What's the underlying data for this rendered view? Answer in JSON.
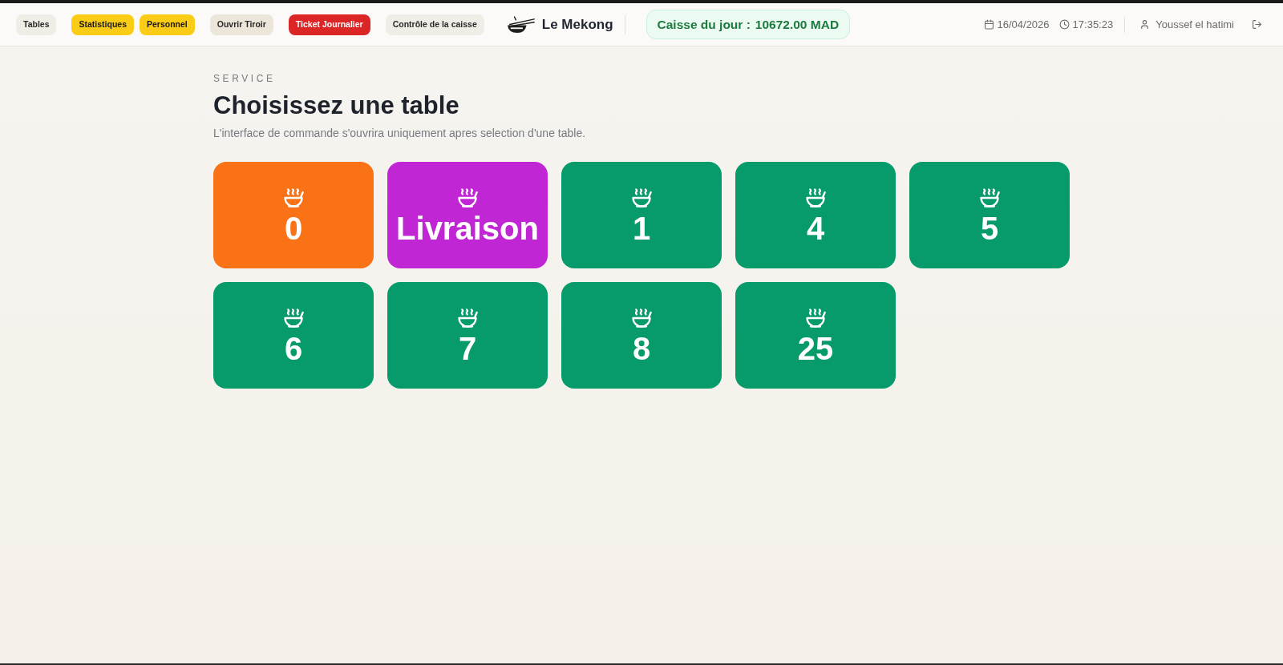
{
  "header": {
    "nav_groups": [
      {
        "buttons": [
          {
            "label": "Tables",
            "kind": "plain"
          }
        ]
      },
      {
        "buttons": [
          {
            "label": "Statistiques",
            "kind": "accent"
          },
          {
            "label": "Personnel",
            "kind": "accent"
          }
        ]
      },
      {
        "buttons": [
          {
            "label": "Ouvrir Tiroir",
            "kind": "muted"
          }
        ]
      },
      {
        "buttons": [
          {
            "label": "Ticket Journalier",
            "kind": "danger"
          }
        ]
      },
      {
        "buttons": [
          {
            "label": "Contrôle de la caisse",
            "kind": "plain"
          }
        ]
      }
    ],
    "brand": {
      "name": "Le Mekong"
    },
    "cash_badge": {
      "label": "Caisse du jour :",
      "value": "10672.00 MAD"
    },
    "date": "16/04/2026",
    "time": "17:35:23",
    "user": {
      "name": "Youssef el hatimi"
    }
  },
  "main": {
    "eyebrow": "SERVICE",
    "title": "Choisissez une table",
    "subtitle": "L'interface de commande s'ouvrira uniquement apres selection d'une table.",
    "tables": [
      {
        "label": "0",
        "color": "#f97316"
      },
      {
        "label": "Livraison",
        "color": "#c026d3"
      },
      {
        "label": "1",
        "color": "#079a6b"
      },
      {
        "label": "4",
        "color": "#079a6b"
      },
      {
        "label": "5",
        "color": "#079a6b"
      },
      {
        "label": "6",
        "color": "#079a6b"
      },
      {
        "label": "7",
        "color": "#079a6b"
      },
      {
        "label": "8",
        "color": "#079a6b"
      },
      {
        "label": "25",
        "color": "#079a6b"
      }
    ]
  }
}
